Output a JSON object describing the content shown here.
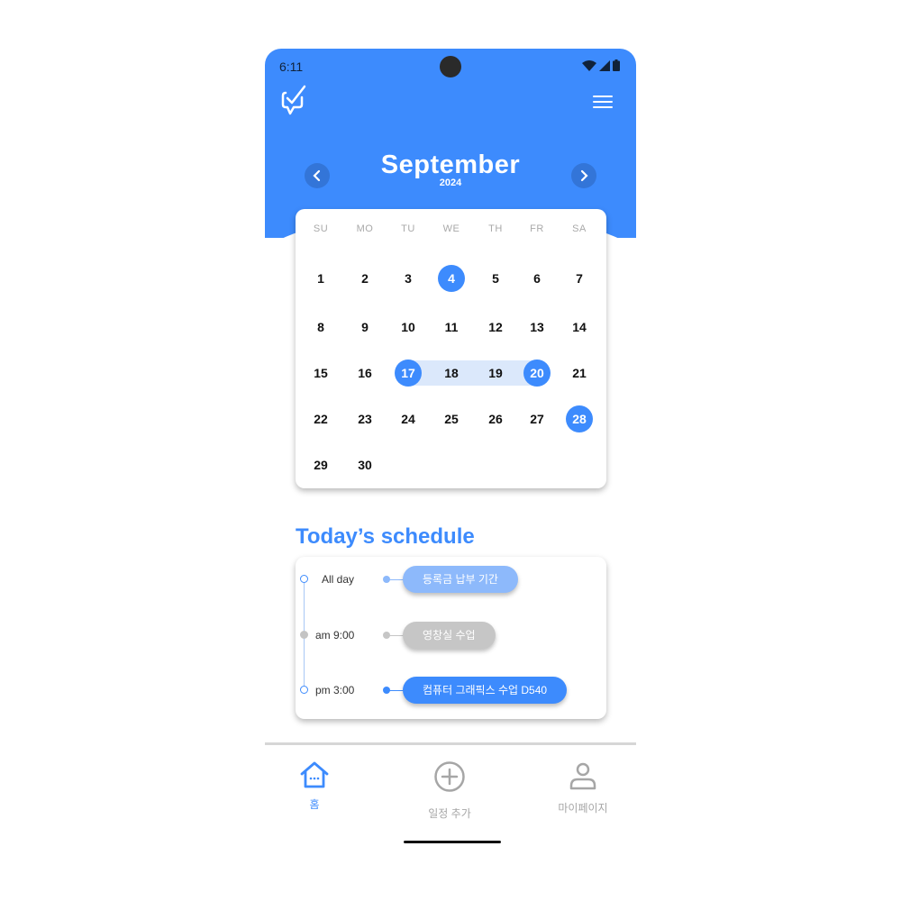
{
  "status_bar": {
    "time": "6:11"
  },
  "header": {
    "month": "September",
    "year": "2024"
  },
  "calendar": {
    "weekdays": [
      "SU",
      "MO",
      "TU",
      "WE",
      "TH",
      "FR",
      "SA"
    ],
    "days": [
      "1",
      "2",
      "3",
      "4",
      "5",
      "6",
      "7",
      "8",
      "9",
      "10",
      "11",
      "12",
      "13",
      "14",
      "15",
      "16",
      "17",
      "18",
      "19",
      "20",
      "21",
      "22",
      "23",
      "24",
      "25",
      "26",
      "27",
      "28",
      "29",
      "30"
    ],
    "first_weekday_index": 0,
    "selected_days": [
      "4",
      "17",
      "20",
      "28"
    ],
    "range": [
      "17",
      "20"
    ],
    "accent_color": "#3d8bfd",
    "range_color": "#dbe8fb"
  },
  "schedule": {
    "title": "Today’s schedule",
    "items": [
      {
        "time": "All day",
        "label": "등록금 납부 기간",
        "color": "#8db9fb",
        "dot": "hollow"
      },
      {
        "time": "am 9:00",
        "label": "영창실 수업",
        "color": "#c6c6c6",
        "dot": "filled"
      },
      {
        "time": "pm 3:00",
        "label": "컴퓨터 그래픽스 수업 D540",
        "color": "#3d8bfd",
        "dot": "hollow"
      }
    ]
  },
  "tabs": [
    {
      "label": "홈",
      "icon": "home-icon",
      "active": true
    },
    {
      "label": "일정 추가",
      "icon": "add-circle-icon",
      "active": false
    },
    {
      "label": "마이페이지",
      "icon": "person-icon",
      "active": false
    }
  ],
  "colors": {
    "primary": "#3d8bfd",
    "inactive": "#a6a6a6"
  }
}
